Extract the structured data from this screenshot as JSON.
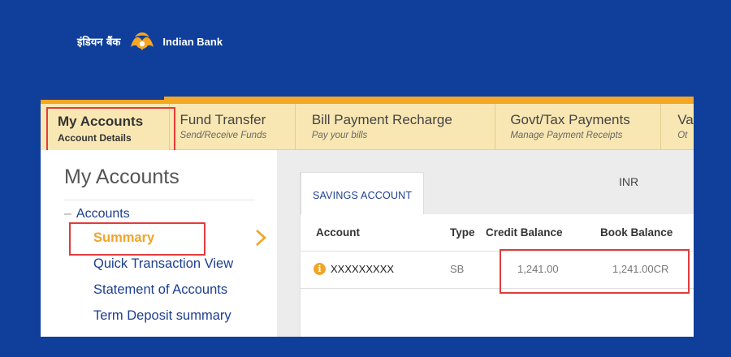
{
  "brand": {
    "hindi_name": "इंडियन बैंक",
    "english_name": "Indian Bank",
    "logo_icon": "indian-bank-logo"
  },
  "colors": {
    "background": "#0f3f9a",
    "accent": "#f5a623",
    "tab_bg": "#f9e7b3",
    "link": "#1d3f8f",
    "active": "#f0a52a",
    "highlight_box": "#e23b3b"
  },
  "tabs": [
    {
      "title": "My Accounts",
      "subtitle": "Account Details"
    },
    {
      "title": "Fund Transfer",
      "subtitle": "Send/Receive Funds"
    },
    {
      "title": "Bill Payment Recharge",
      "subtitle": "Pay your bills"
    },
    {
      "title": "Govt/Tax Payments",
      "subtitle": "Manage Payment Receipts"
    },
    {
      "title": "Va",
      "subtitle": "Ot"
    }
  ],
  "sidebar": {
    "title": "My Accounts",
    "group_label": "Accounts",
    "items": [
      {
        "label": "Summary",
        "active": true
      },
      {
        "label": "Quick Transaction View"
      },
      {
        "label": "Statement of Accounts"
      },
      {
        "label": "Term Deposit summary"
      }
    ],
    "chevron_icon": "chevron-right-icon"
  },
  "content": {
    "active_tab": "SAVINGS ACCOUNT",
    "currency": "INR",
    "columns": [
      "Account",
      "Type",
      "Credit Balance",
      "Book Balance"
    ],
    "rows": [
      {
        "account": "XXXXXXXXX",
        "type": "SB",
        "credit_balance": "1,241.00",
        "book_balance": "1,241.00CR",
        "info_icon": "info-icon"
      }
    ]
  }
}
